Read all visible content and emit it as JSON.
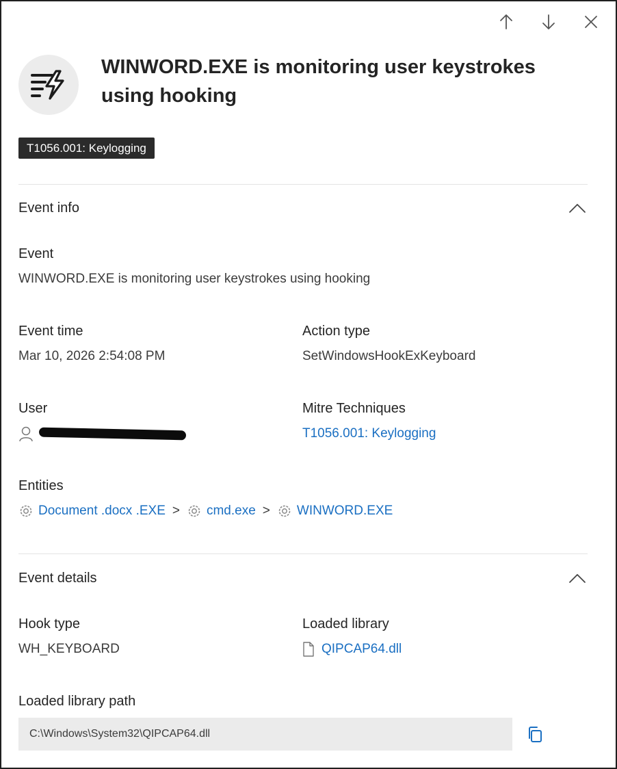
{
  "toolbar": {
    "prev_icon": "arrow-up-icon",
    "next_icon": "arrow-down-icon",
    "close_icon": "close-icon"
  },
  "header": {
    "icon": "keyboard-lightning-icon",
    "title": "WINWORD.EXE is monitoring user keystrokes using hooking",
    "tag": "T1056.001: Keylogging"
  },
  "event_info": {
    "heading": "Event info",
    "event_label": "Event",
    "event_value": "WINWORD.EXE is monitoring user keystrokes using hooking",
    "time_label": "Event time",
    "time_value": "Mar 10, 2026 2:54:08 PM",
    "action_label": "Action type",
    "action_value": "SetWindowsHookExKeyboard",
    "user_label": "User",
    "mitre_label": "Mitre Techniques",
    "mitre_value": "T1056.001: Keylogging",
    "entities_label": "Entities",
    "entities": [
      "Document .docx .EXE",
      "cmd.exe",
      "WINWORD.EXE"
    ],
    "entity_separator": ">"
  },
  "event_details": {
    "heading": "Event details",
    "hook_label": "Hook type",
    "hook_value": "WH_KEYBOARD",
    "library_label": "Loaded library",
    "library_value": "QIPCAP64.dll",
    "path_label": "Loaded library path",
    "path_value": "C:\\Windows\\System32\\QIPCAP64.dll"
  },
  "colors": {
    "link": "#1a6fc2",
    "tag_background": "#2b2b2b",
    "path_background": "#ebebeb"
  }
}
